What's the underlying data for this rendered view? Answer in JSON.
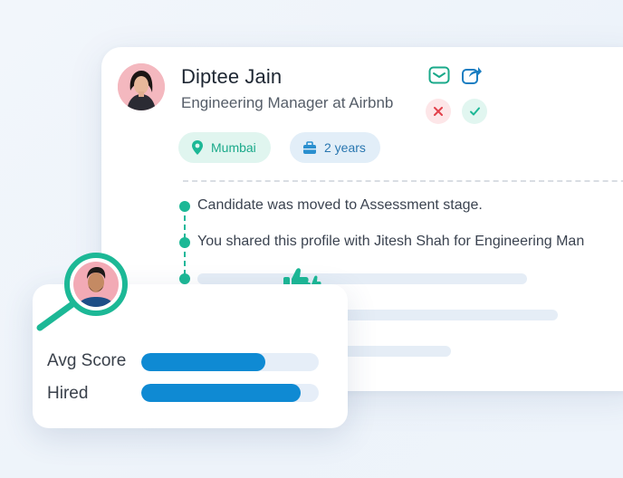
{
  "profile": {
    "name": "Diptee Jain",
    "title": "Engineering Manager at Airbnb",
    "location": "Mumbai",
    "experience": "2 years"
  },
  "actions": {
    "email_icon": "mail-icon",
    "share_icon": "share-icon",
    "reject_icon": "close-icon",
    "approve_icon": "check-icon"
  },
  "timeline": [
    "Candidate was moved to Assessment stage.",
    "You shared this profile with Jitesh Shah for Engineering Man"
  ],
  "stats": {
    "avg_score_label": "Avg Score",
    "avg_score_value": 0.7,
    "hired_label": "Hired",
    "hired_value": 0.9
  },
  "colors": {
    "accent_green": "#1cb896",
    "accent_blue": "#0f8ad3",
    "reject_red": "#e2414b"
  }
}
